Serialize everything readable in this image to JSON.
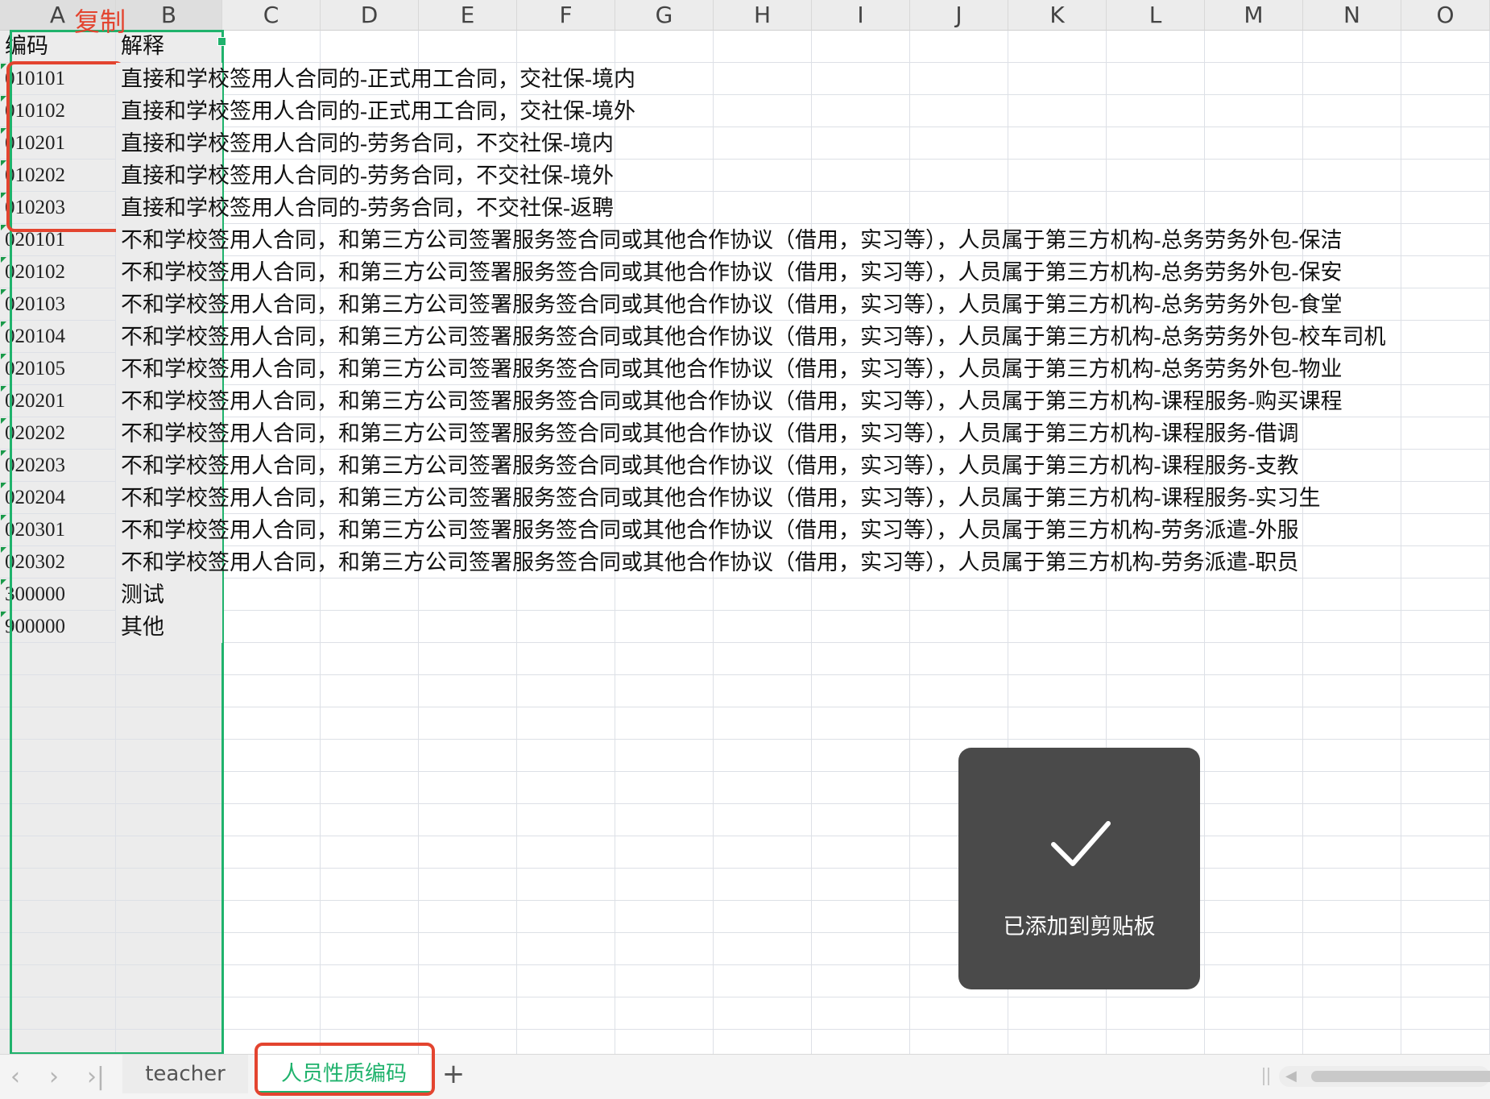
{
  "columns": [
    "A",
    "B",
    "C",
    "D",
    "E",
    "F",
    "G",
    "H",
    "I",
    "J",
    "K",
    "L",
    "M",
    "N",
    "O"
  ],
  "header_row": {
    "code": "编码",
    "desc": "解释"
  },
  "rows": [
    {
      "code": "010101",
      "desc": "直接和学校签用人合同的-正式用工合同，交社保-境内"
    },
    {
      "code": "010102",
      "desc": "直接和学校签用人合同的-正式用工合同，交社保-境外"
    },
    {
      "code": "010201",
      "desc": "直接和学校签用人合同的-劳务合同，不交社保-境内"
    },
    {
      "code": "010202",
      "desc": "直接和学校签用人合同的-劳务合同，不交社保-境外"
    },
    {
      "code": "010203",
      "desc": "直接和学校签用人合同的-劳务合同，不交社保-返聘"
    },
    {
      "code": "020101",
      "desc": "不和学校签用人合同，和第三方公司签署服务签合同或其他合作协议（借用，实习等），人员属于第三方机构-总务劳务外包-保洁"
    },
    {
      "code": "020102",
      "desc": "不和学校签用人合同，和第三方公司签署服务签合同或其他合作协议（借用，实习等），人员属于第三方机构-总务劳务外包-保安"
    },
    {
      "code": "020103",
      "desc": "不和学校签用人合同，和第三方公司签署服务签合同或其他合作协议（借用，实习等），人员属于第三方机构-总务劳务外包-食堂"
    },
    {
      "code": "020104",
      "desc": "不和学校签用人合同，和第三方公司签署服务签合同或其他合作协议（借用，实习等），人员属于第三方机构-总务劳务外包-校车司机"
    },
    {
      "code": "020105",
      "desc": "不和学校签用人合同，和第三方公司签署服务签合同或其他合作协议（借用，实习等），人员属于第三方机构-总务劳务外包-物业"
    },
    {
      "code": "020201",
      "desc": "不和学校签用人合同，和第三方公司签署服务签合同或其他合作协议（借用，实习等），人员属于第三方机构-课程服务-购买课程"
    },
    {
      "code": "020202",
      "desc": "不和学校签用人合同，和第三方公司签署服务签合同或其他合作协议（借用，实习等），人员属于第三方机构-课程服务-借调"
    },
    {
      "code": "020203",
      "desc": "不和学校签用人合同，和第三方公司签署服务签合同或其他合作协议（借用，实习等），人员属于第三方机构-课程服务-支教"
    },
    {
      "code": "020204",
      "desc": "不和学校签用人合同，和第三方公司签署服务签合同或其他合作协议（借用，实习等），人员属于第三方机构-课程服务-实习生"
    },
    {
      "code": "020301",
      "desc": "不和学校签用人合同，和第三方公司签署服务签合同或其他合作协议（借用，实习等），人员属于第三方机构-劳务派遣-外服"
    },
    {
      "code": "020302",
      "desc": "不和学校签用人合同，和第三方公司签署服务签合同或其他合作协议（借用，实习等），人员属于第三方机构-劳务派遣-职员"
    },
    {
      "code": "300000",
      "desc": "测试"
    },
    {
      "code": "900000",
      "desc": "其他"
    }
  ],
  "annotation": {
    "copy_label": "复制"
  },
  "toast": {
    "message": "已添加到剪贴板"
  },
  "tabs": [
    {
      "label": "teacher",
      "active": false
    },
    {
      "label": "人员性质编码",
      "active": true
    }
  ],
  "tabbar": {
    "add_symbol": "+"
  },
  "colors": {
    "accent": "#1fb26c",
    "annotation": "#e3442f",
    "toast_bg": "#4a4a4a"
  }
}
